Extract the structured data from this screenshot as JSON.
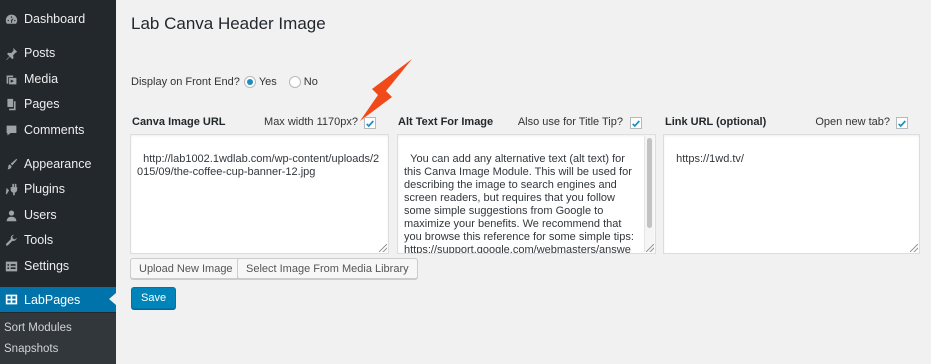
{
  "sidebar": {
    "items": [
      {
        "label": "Dashboard"
      },
      {
        "label": "Posts"
      },
      {
        "label": "Media"
      },
      {
        "label": "Pages"
      },
      {
        "label": "Comments"
      },
      {
        "label": "Appearance"
      },
      {
        "label": "Plugins"
      },
      {
        "label": "Users"
      },
      {
        "label": "Tools"
      },
      {
        "label": "Settings"
      },
      {
        "label": "LabPages"
      }
    ],
    "submenu": [
      {
        "label": "Sort Modules"
      },
      {
        "label": "Snapshots"
      }
    ]
  },
  "main": {
    "title": "Lab Canva Header Image",
    "display": {
      "label": "Display on Front End?",
      "options": [
        "Yes",
        "No"
      ],
      "selected": "Yes"
    },
    "fields": {
      "canva_url": {
        "label": "Canva Image URL",
        "option_label": "Max width 1170px?",
        "checked": true,
        "value": "http://lab1002.1wdlab.com/wp-content/uploads/2015/09/the-coffee-cup-banner-12.jpg"
      },
      "alt_text": {
        "label": "Alt Text For Image",
        "option_label": "Also use for Title Tip?",
        "checked": true,
        "value": "You can add any alternative text (alt text) for this Canva Image Module. This will be used for describing the image to search engines and screen readers, but requires that you follow some simple suggestions from Google to maximize your benefits. We recommend that you browse this reference for some simple tips: https://support.google.com/webmasters/answe"
      },
      "link_url": {
        "label": "Link URL (optional)",
        "option_label": "Open new tab?",
        "checked": true,
        "value": "https://1wd.tv/"
      }
    },
    "buttons": {
      "upload": "Upload New Image",
      "select": "Select Image From Media Library",
      "save": "Save"
    }
  },
  "colors": {
    "sidebar_bg": "#23282d",
    "accent": "#0073aa",
    "primary_button": "#0085ba",
    "annotation_arrow": "#f04a1a"
  }
}
